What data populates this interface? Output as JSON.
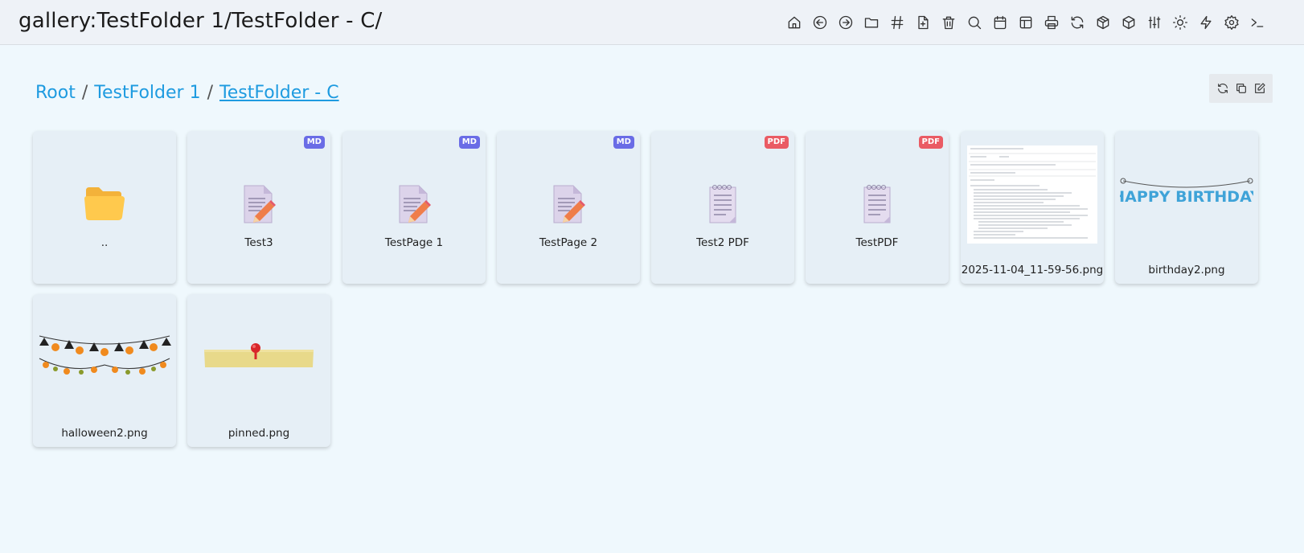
{
  "header": {
    "title": "gallery:TestFolder 1/TestFolder - C/",
    "toolbar": [
      {
        "name": "home-icon"
      },
      {
        "name": "back-icon"
      },
      {
        "name": "forward-icon"
      },
      {
        "name": "folder-icon"
      },
      {
        "name": "hash-icon"
      },
      {
        "name": "new-file-icon"
      },
      {
        "name": "trash-icon"
      },
      {
        "name": "search-icon"
      },
      {
        "name": "calendar-icon"
      },
      {
        "name": "layout-icon"
      },
      {
        "name": "print-icon"
      },
      {
        "name": "refresh-icon"
      },
      {
        "name": "package-icon"
      },
      {
        "name": "box-icon"
      },
      {
        "name": "sliders-icon"
      },
      {
        "name": "sun-icon"
      },
      {
        "name": "lightning-icon"
      },
      {
        "name": "settings-icon"
      },
      {
        "name": "terminal-icon"
      }
    ]
  },
  "breadcrumb": {
    "items": [
      "Root",
      "TestFolder 1",
      "TestFolder - C"
    ],
    "separator": "/"
  },
  "actions": [
    {
      "name": "refresh-icon"
    },
    {
      "name": "copy-icon"
    },
    {
      "name": "edit-icon"
    }
  ],
  "tiles": [
    {
      "label": "..",
      "kind": "folder",
      "badge": ""
    },
    {
      "label": "Test3",
      "kind": "markdown",
      "badge": "MD"
    },
    {
      "label": "TestPage 1",
      "kind": "markdown",
      "badge": "MD"
    },
    {
      "label": "TestPage 2",
      "kind": "markdown",
      "badge": "MD"
    },
    {
      "label": "Test2 PDF",
      "kind": "pdf",
      "badge": "PDF"
    },
    {
      "label": "TestPDF",
      "kind": "pdf",
      "badge": "PDF"
    },
    {
      "label": "2025-11-04_11-59-56.png",
      "kind": "image-document"
    },
    {
      "label": "birthday2.png",
      "kind": "image-banner",
      "banner_text": "HAPPY BIRTHDAY"
    },
    {
      "label": "halloween2.png",
      "kind": "image-garland"
    },
    {
      "label": "pinned.png",
      "kind": "image-note"
    }
  ],
  "colors": {
    "link": "#1e9be0",
    "md_badge": "#6a6ce6",
    "pdf_badge": "#ea5b64",
    "tile_bg": "#e6eff6",
    "page_bg": "#eff8fd"
  }
}
